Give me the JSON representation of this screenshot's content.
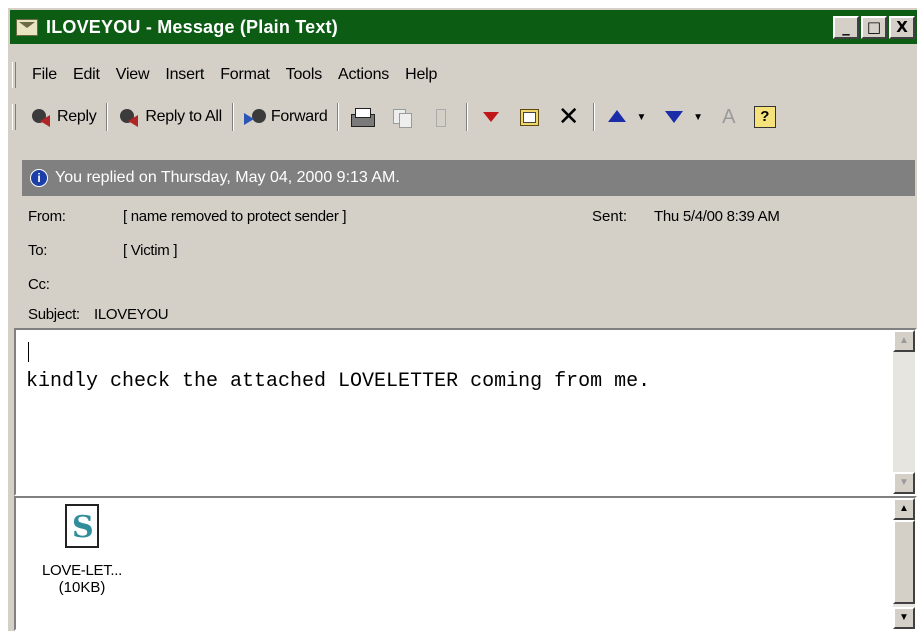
{
  "window": {
    "title": "ILOVEYOU - Message (Plain Text)",
    "controls": {
      "minimize": "_",
      "maximize": "□",
      "close": "X"
    }
  },
  "menu": [
    "File",
    "Edit",
    "View",
    "Insert",
    "Format",
    "Tools",
    "Actions",
    "Help"
  ],
  "toolbar": {
    "reply": "Reply",
    "reply_all": "Reply to All",
    "forward": "Forward",
    "font_icon": "A",
    "help_icon": "?"
  },
  "info_bar": {
    "icon": "i",
    "text": "You replied on Thursday, May 04, 2000 9:13 AM."
  },
  "header": {
    "from_label": "From:",
    "from_value": "[ name removed to protect sender ]",
    "sent_label": "Sent:",
    "sent_value": "Thu 5/4/00 8:39 AM",
    "to_label": "To:",
    "to_value": "[ Victim ]",
    "cc_label": "Cc:",
    "cc_value": "",
    "subject_label": "Subject:",
    "subject_value": "ILOVEYOU"
  },
  "body": {
    "text": "kindly check the attached LOVELETTER coming from me."
  },
  "attachment": {
    "name": "LOVE-LET...",
    "size": "(10KB)"
  },
  "colors": {
    "title_bar": "#0c5c14",
    "info_bar": "#808080",
    "chrome": "#d4d0c8"
  }
}
